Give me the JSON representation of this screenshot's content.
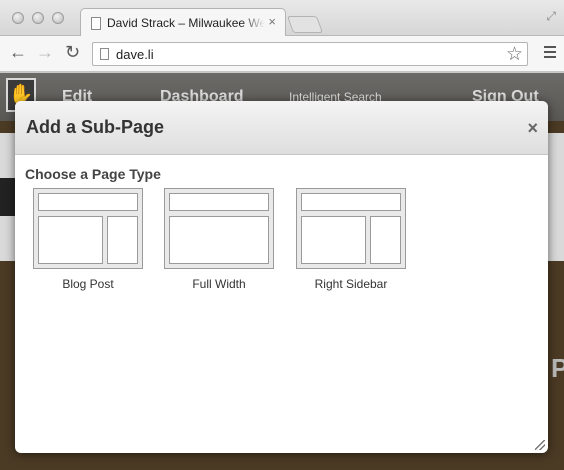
{
  "browser": {
    "tab_title": "David Strack – Milwaukee Web Developer",
    "tab_close": "×",
    "url": "dave.li",
    "back_glyph": "←",
    "forward_glyph": "→",
    "reload_glyph": "↻",
    "star_glyph": "☆",
    "fullscreen_glyph": "⤢"
  },
  "site": {
    "nav_items": [
      "Edit",
      "Dashboard",
      "Intelligent Search",
      "Sign Out"
    ],
    "edge_text": "P"
  },
  "modal": {
    "title": "Add a Sub-Page",
    "close_glyph": "×",
    "section_label": "Choose a Page Type",
    "page_types": [
      {
        "label": "Blog Post",
        "layout": "header-main-sidebar"
      },
      {
        "label": "Full Width",
        "layout": "header-full"
      },
      {
        "label": "Right Sidebar",
        "layout": "header-main-sidebar"
      }
    ]
  },
  "colors": {
    "site_background": "#4b3a24",
    "modal_header": "#dedede",
    "thumb_frame": "#9a9a9a"
  }
}
